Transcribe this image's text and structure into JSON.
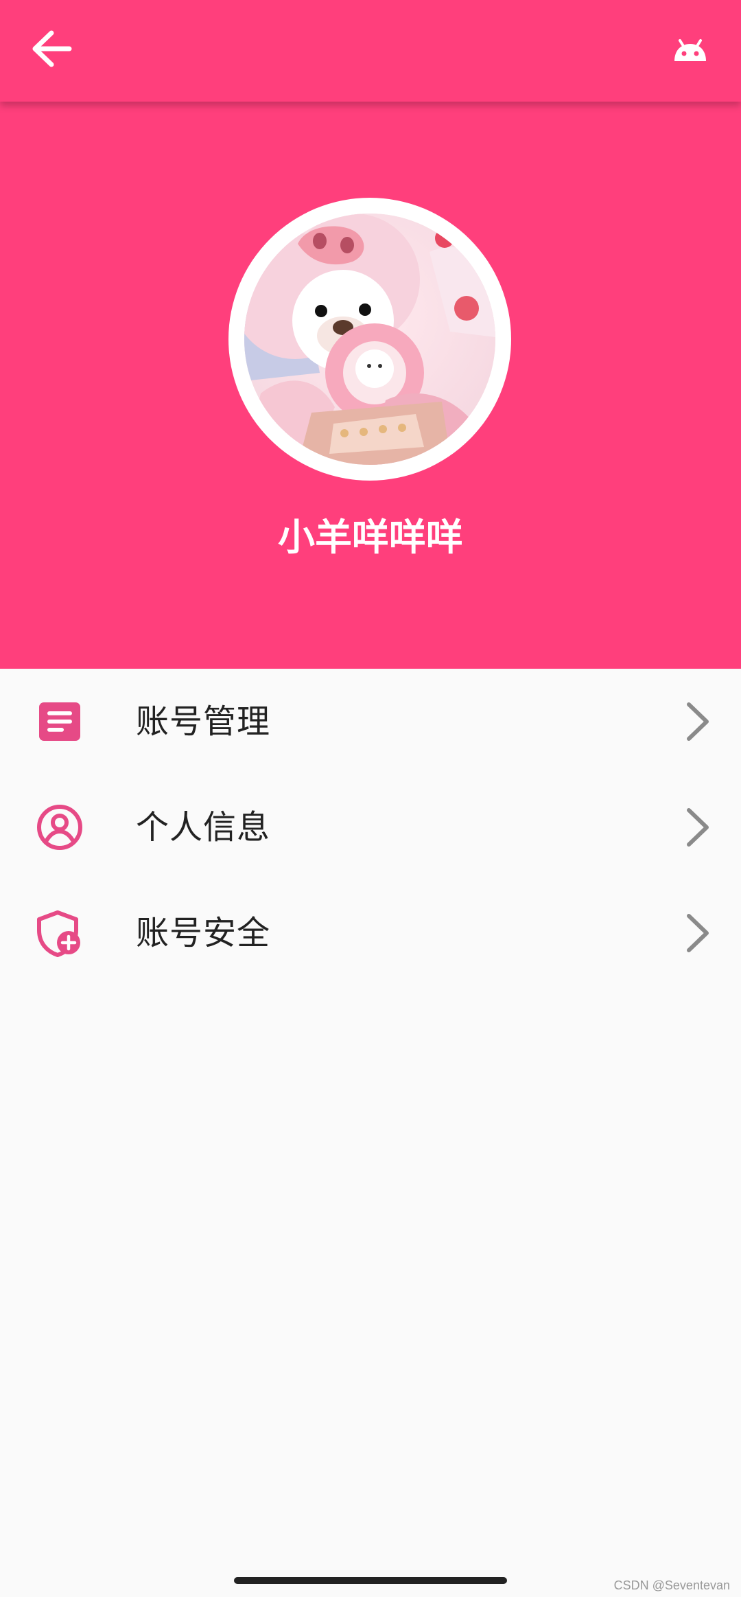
{
  "appbar": {
    "back_icon": "arrow-left-icon",
    "action_icon": "android-icon"
  },
  "profile": {
    "avatar_description": "avatar-photo",
    "username": "小羊咩咩咩"
  },
  "menu": {
    "items": [
      {
        "label": "账号管理",
        "icon": "document-icon"
      },
      {
        "label": "个人信息",
        "icon": "user-circle-icon"
      },
      {
        "label": "账号安全",
        "icon": "shield-plus-icon"
      }
    ],
    "chevron_icon": "chevron-right-icon"
  },
  "watermark": "CSDN @Seventevan",
  "colors": {
    "brand": "#ff3f7c",
    "background": "#fafafa",
    "icon_tint": "#e64a86",
    "chevron": "#8a8a8a",
    "text": "#222222"
  }
}
